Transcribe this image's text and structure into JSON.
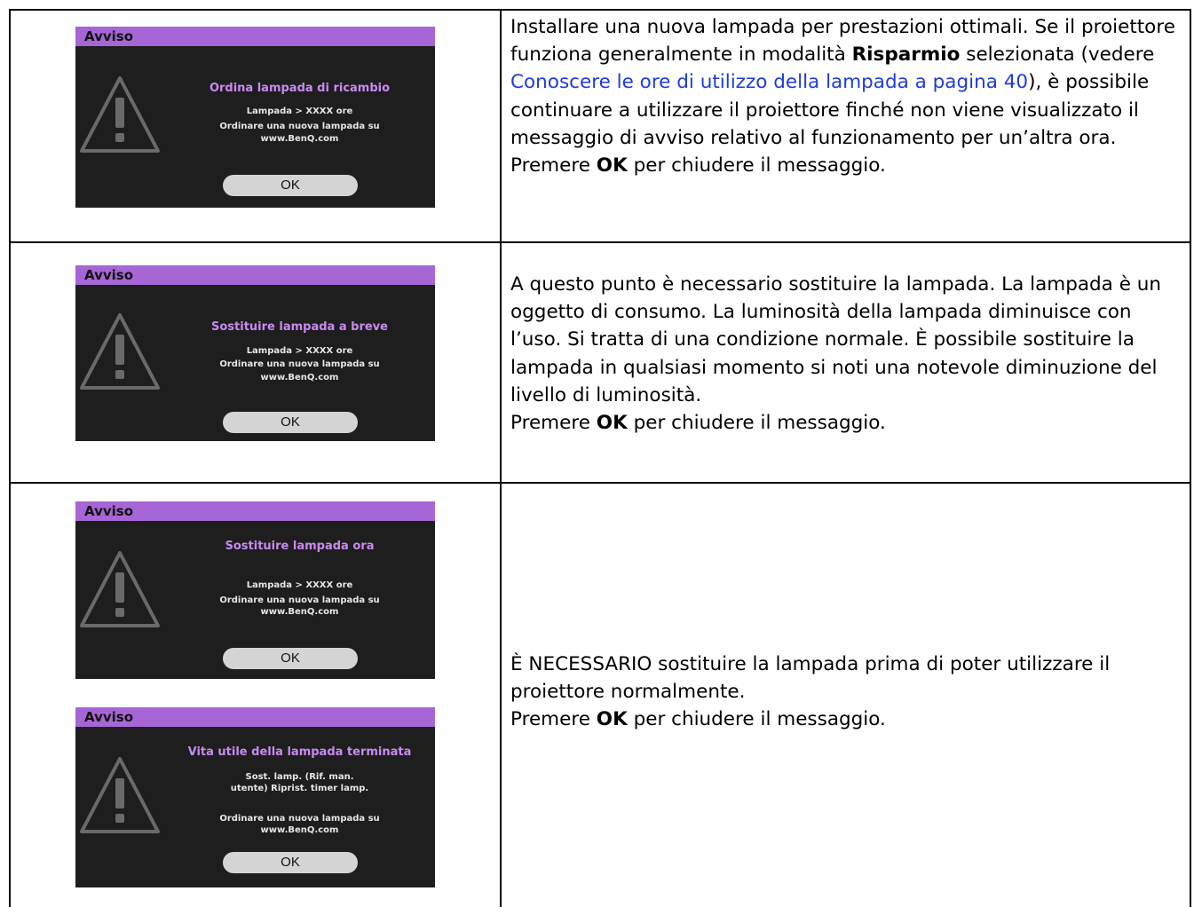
{
  "rows": [
    {
      "dialogs": [
        {
          "title": "Avviso",
          "heading": "Ordina lampada di ricambio",
          "lines": [
            "Lampada > XXXX ore",
            "Ordinare una nuova lampada su",
            "www.BenQ.com"
          ],
          "button": "OK"
        }
      ],
      "text_before": "Installare una nuova lampada per prestazioni ottimali. Se il proiettore funziona generalmente in modalità ",
      "bold_mode": "Risparmio",
      "text_mid": " selezionata (vedere ",
      "link_text": "Conoscere le ore di utilizzo della lampada a pagina 40",
      "text_after": "), è possibile continuare a utilizzare il proiettore finché non viene visualizzato il messaggio di avviso relativo al funzionamento per un’altra ora.",
      "press_prefix": "Premere ",
      "press_key": "OK",
      "press_suffix": " per chiudere il messaggio."
    },
    {
      "dialogs": [
        {
          "title": "Avviso",
          "heading": "Sostituire lampada a breve",
          "lines": [
            "Lampada > XXXX ore",
            "Ordinare una nuova lampada su",
            "www.BenQ.com"
          ],
          "button": "OK"
        }
      ],
      "text": "A questo punto è necessario sostituire la lampada. La lampada è un oggetto di consumo. La luminosità della lampada diminuisce con l’uso. Si tratta di una condizione normale. È possibile sostituire la lampada in qualsiasi momento si noti una notevole diminuzione del livello di luminosità.",
      "press_prefix": "Premere ",
      "press_key": "OK",
      "press_suffix": " per chiudere il messaggio."
    },
    {
      "dialogs": [
        {
          "title": "Avviso",
          "heading": "Sostituire lampada ora",
          "lines": [
            "Lampada > XXXX ore",
            "Ordinare una nuova lampada su",
            "www.BenQ.com"
          ],
          "button": "OK"
        },
        {
          "title": "Avviso",
          "heading": "Vita utile della lampada terminata",
          "lines": [
            "Sost. lamp. (Rif. man.",
            "utente) Riprist. timer lamp.",
            "",
            "Ordinare una nuova lampada su",
            "www.BenQ.com"
          ],
          "button": "OK"
        }
      ],
      "text": "È NECESSARIO sostituire la lampada prima di poter utilizzare il proiettore normalmente.",
      "press_prefix": "Premere ",
      "press_key": "OK",
      "press_suffix": " per chiudere il messaggio."
    }
  ],
  "colors": {
    "title_bar": "#a766d6",
    "dialog_bg": "#1e1e1e",
    "heading": "#c98af0",
    "button": "#d4d4d4",
    "link": "#1f3ae0"
  },
  "icons": {
    "warning": "warning-triangle-icon"
  }
}
